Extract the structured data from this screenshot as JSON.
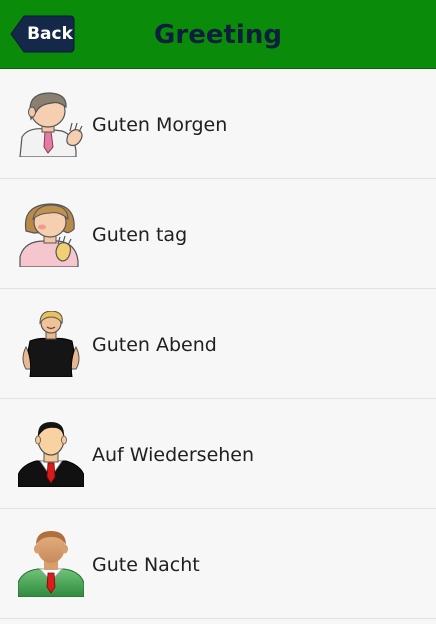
{
  "header": {
    "title": "Greeting",
    "back_label": "Back"
  },
  "colors": {
    "header_bg": "#0a8c0a",
    "back_bg": "#14294a",
    "title_color": "#0d1f3c"
  },
  "greetings": [
    {
      "label": "Guten Morgen",
      "icon": "man-waving-icon"
    },
    {
      "label": "Guten tag",
      "icon": "woman-waving-icon"
    },
    {
      "label": "Guten Abend",
      "icon": "woman-black-dress-icon"
    },
    {
      "label": "Auf Wiedersehen",
      "icon": "man-suit-icon"
    },
    {
      "label": "Gute Nacht",
      "icon": "man-green-shirt-icon"
    }
  ]
}
